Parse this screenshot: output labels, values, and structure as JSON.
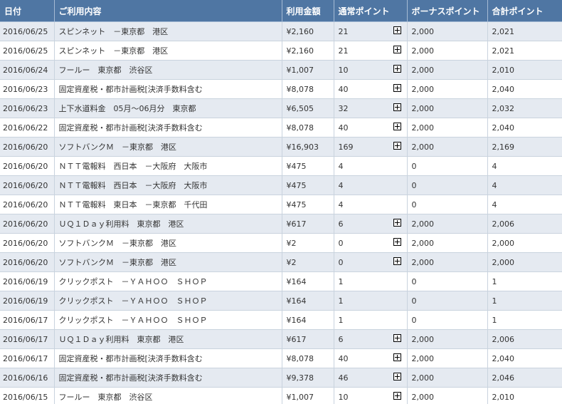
{
  "table": {
    "headers": {
      "date": "日付",
      "description": "ご利用内容",
      "amount": "利用金額",
      "regular_points": "通常ポイント",
      "bonus_points": "ボーナスポイント",
      "total_points": "合計ポイント"
    },
    "rows": [
      {
        "date": "2016/06/25",
        "description": "スピンネット　－東京都　港区",
        "amount": "¥2,160",
        "regular_points": "21",
        "expandable": true,
        "bonus_points": "2,000",
        "total_points": "2,021"
      },
      {
        "date": "2016/06/25",
        "description": "スピンネット　－東京都　港区",
        "amount": "¥2,160",
        "regular_points": "21",
        "expandable": true,
        "bonus_points": "2,000",
        "total_points": "2,021"
      },
      {
        "date": "2016/06/24",
        "description": "フールー　東京都　渋谷区",
        "amount": "¥1,007",
        "regular_points": "10",
        "expandable": true,
        "bonus_points": "2,000",
        "total_points": "2,010"
      },
      {
        "date": "2016/06/23",
        "description": "固定資産税・都市計画税[決済手数料含む",
        "amount": "¥8,078",
        "regular_points": "40",
        "expandable": true,
        "bonus_points": "2,000",
        "total_points": "2,040"
      },
      {
        "date": "2016/06/23",
        "description": "上下水道料金　05月～06月分　東京都",
        "amount": "¥6,505",
        "regular_points": "32",
        "expandable": true,
        "bonus_points": "2,000",
        "total_points": "2,032"
      },
      {
        "date": "2016/06/22",
        "description": "固定資産税・都市計画税[決済手数料含む",
        "amount": "¥8,078",
        "regular_points": "40",
        "expandable": true,
        "bonus_points": "2,000",
        "total_points": "2,040"
      },
      {
        "date": "2016/06/20",
        "description": "ソフトバンクＭ　－東京都　港区",
        "amount": "¥16,903",
        "regular_points": "169",
        "expandable": true,
        "bonus_points": "2,000",
        "total_points": "2,169"
      },
      {
        "date": "2016/06/20",
        "description": "ＮＴＴ電報料　西日本　－大阪府　大阪市",
        "amount": "¥475",
        "regular_points": "4",
        "expandable": false,
        "bonus_points": "0",
        "total_points": "4"
      },
      {
        "date": "2016/06/20",
        "description": "ＮＴＴ電報料　西日本　－大阪府　大阪市",
        "amount": "¥475",
        "regular_points": "4",
        "expandable": false,
        "bonus_points": "0",
        "total_points": "4"
      },
      {
        "date": "2016/06/20",
        "description": "ＮＴＴ電報料　東日本　－東京都　千代田",
        "amount": "¥475",
        "regular_points": "4",
        "expandable": false,
        "bonus_points": "0",
        "total_points": "4"
      },
      {
        "date": "2016/06/20",
        "description": "ＵＱ１Ｄａｙ利用料　東京都　港区",
        "amount": "¥617",
        "regular_points": "6",
        "expandable": true,
        "bonus_points": "2,000",
        "total_points": "2,006"
      },
      {
        "date": "2016/06/20",
        "description": "ソフトバンクＭ　－東京都　港区",
        "amount": "¥2",
        "regular_points": "0",
        "expandable": true,
        "bonus_points": "2,000",
        "total_points": "2,000"
      },
      {
        "date": "2016/06/20",
        "description": "ソフトバンクＭ　－東京都　港区",
        "amount": "¥2",
        "regular_points": "0",
        "expandable": true,
        "bonus_points": "2,000",
        "total_points": "2,000"
      },
      {
        "date": "2016/06/19",
        "description": "クリックポスト　－ＹＡＨＯＯ　ＳＨＯＰ",
        "amount": "¥164",
        "regular_points": "1",
        "expandable": false,
        "bonus_points": "0",
        "total_points": "1"
      },
      {
        "date": "2016/06/19",
        "description": "クリックポスト　－ＹＡＨＯＯ　ＳＨＯＰ",
        "amount": "¥164",
        "regular_points": "1",
        "expandable": false,
        "bonus_points": "0",
        "total_points": "1"
      },
      {
        "date": "2016/06/17",
        "description": "クリックポスト　－ＹＡＨＯＯ　ＳＨＯＰ",
        "amount": "¥164",
        "regular_points": "1",
        "expandable": false,
        "bonus_points": "0",
        "total_points": "1"
      },
      {
        "date": "2016/06/17",
        "description": "ＵＱ１Ｄａｙ利用料　東京都　港区",
        "amount": "¥617",
        "regular_points": "6",
        "expandable": true,
        "bonus_points": "2,000",
        "total_points": "2,006"
      },
      {
        "date": "2016/06/17",
        "description": "固定資産税・都市計画税[決済手数料含む",
        "amount": "¥8,078",
        "regular_points": "40",
        "expandable": true,
        "bonus_points": "2,000",
        "total_points": "2,040"
      },
      {
        "date": "2016/06/16",
        "description": "固定資産税・都市計画税[決済手数料含む",
        "amount": "¥9,378",
        "regular_points": "46",
        "expandable": true,
        "bonus_points": "2,000",
        "total_points": "2,046"
      },
      {
        "date": "2016/06/15",
        "description": "フールー　東京都　渋谷区",
        "amount": "¥1,007",
        "regular_points": "10",
        "expandable": true,
        "bonus_points": "2,000",
        "total_points": "2,010"
      }
    ]
  },
  "icons": {
    "expand": "plus-square-icon"
  },
  "colors": {
    "header_bg": "#4f76a3",
    "header_text": "#ffffff",
    "row_alt_bg": "#e5eaf1",
    "row_bg": "#ffffff",
    "text": "#333333"
  }
}
